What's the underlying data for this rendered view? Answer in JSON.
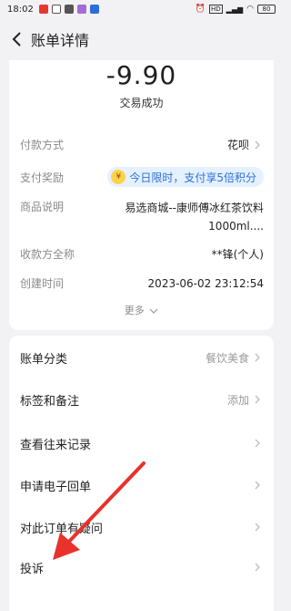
{
  "status_bar": {
    "time": "18:02",
    "battery": "80"
  },
  "nav": {
    "title": "账单详情"
  },
  "summary": {
    "amount": "-9.90",
    "status": "交易成功"
  },
  "details": {
    "payment_method": {
      "label": "付款方式",
      "value": "花呗"
    },
    "reward": {
      "label": "支付奖励",
      "value": "今日限时，支付享5倍积分"
    },
    "description": {
      "label": "商品说明",
      "line1": "易选商城--康师傅冰红茶饮料",
      "line2": "1000ml...."
    },
    "payee": {
      "label": "收款方全称",
      "value": "**锋(个人)"
    },
    "created": {
      "label": "创建时间",
      "value": "2023-06-02 23:12:54"
    },
    "more": "更多"
  },
  "menu": [
    {
      "label": "账单分类",
      "value": "餐饮美食"
    },
    {
      "label": "标签和备注",
      "value": "添加"
    },
    {
      "label": "查看往来记录",
      "value": ""
    },
    {
      "label": "申请电子回单",
      "value": ""
    },
    {
      "label": "对此订单有疑问",
      "value": ""
    },
    {
      "label": "投诉",
      "value": ""
    }
  ],
  "colors": {
    "accent_blue": "#2a6fd8",
    "annotation_red": "#e8322b"
  }
}
